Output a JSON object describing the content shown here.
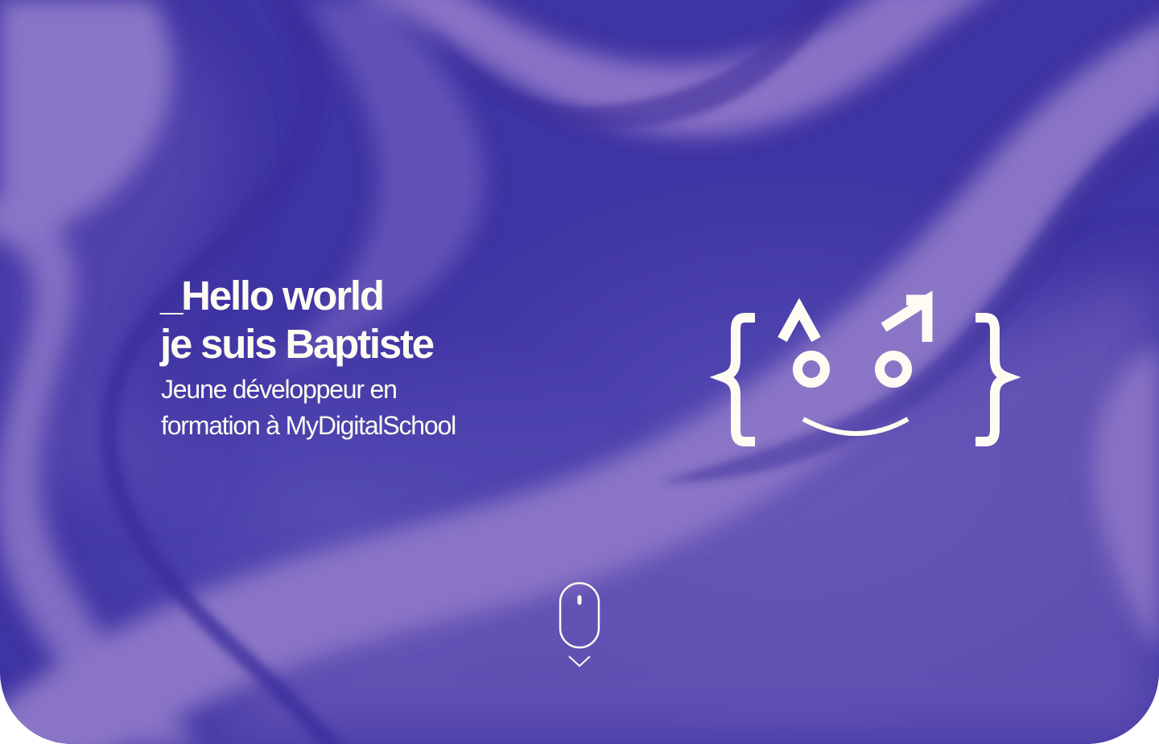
{
  "hero": {
    "headline": {
      "line1": "_Hello world",
      "line2": "je suis Baptiste"
    },
    "subtitle": {
      "line1": "Jeune développeur en",
      "line2": "formation à MyDigitalSchool"
    }
  },
  "logo": {
    "icon": "smiling-face-in-curly-braces-icon"
  },
  "scroll_indicator": {
    "icon": "mouse-scroll-down-icon"
  },
  "colors": {
    "background_dark": "#3a2f9e",
    "background_light": "#8b74c4",
    "text": "#fefcf2"
  }
}
